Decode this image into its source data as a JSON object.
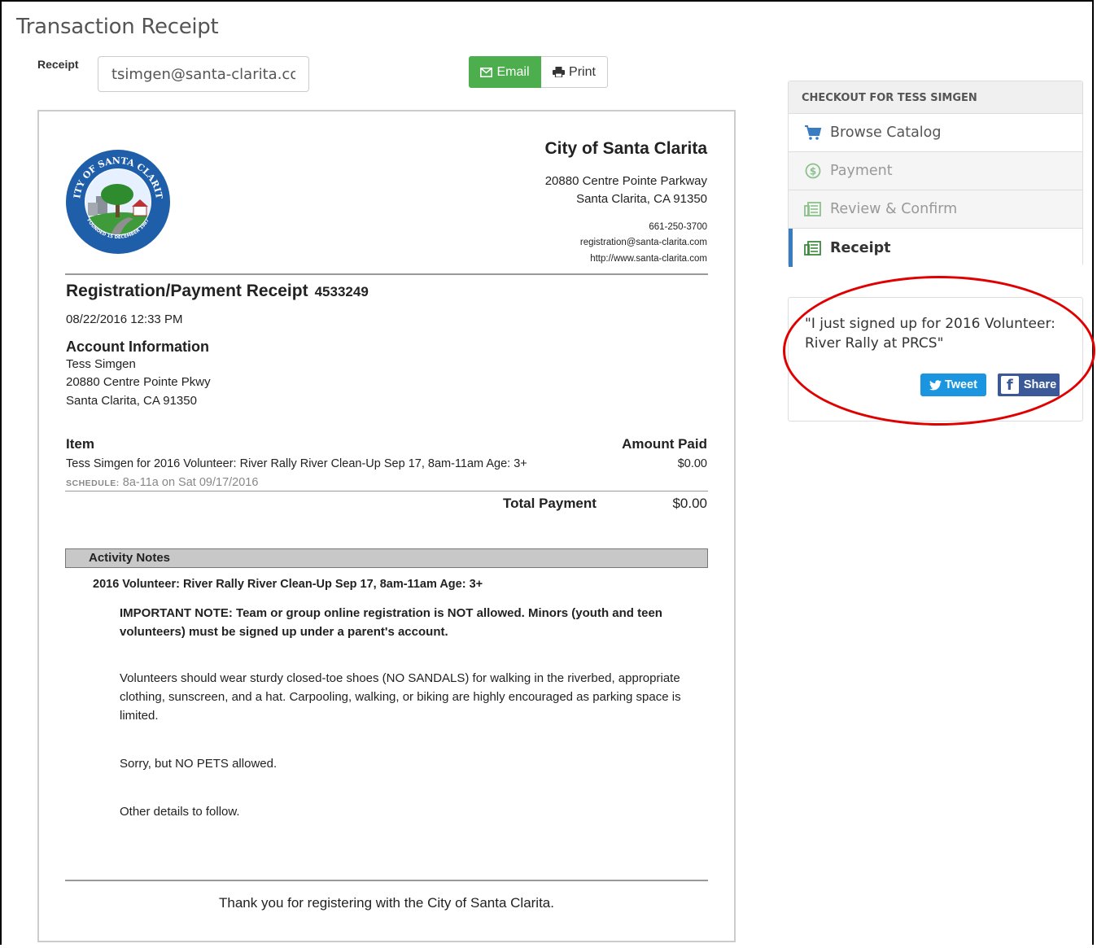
{
  "page": {
    "title": "Transaction Receipt"
  },
  "receipt_form": {
    "label": "Receipt",
    "email_value": "tsimgen@santa-clarita.com",
    "email_button": "Email",
    "print_button": "Print"
  },
  "organization": {
    "name": "City of Santa Clarita",
    "address_line1": "20880 Centre Pointe Parkway",
    "address_line2": "Santa Clarita, CA 91350",
    "phone": "661-250-3700",
    "email": "registration@santa-clarita.com",
    "website": "http://www.santa-clarita.com",
    "seal_text_top": "CITY OF SANTA CLARITA",
    "seal_text_bottom": "FOUNDED 15 DECEMBER 1987"
  },
  "receipt": {
    "title": "Registration/Payment Receipt",
    "number": "4533249",
    "datetime": "08/22/2016 12:33 PM",
    "account_heading": "Account Information",
    "account_name": "Tess Simgen",
    "account_address1": "20880 Centre Pointe Pkwy",
    "account_address2": "Santa Clarita, CA 91350",
    "item_header": "Item",
    "amount_header": "Amount Paid",
    "item_description": "Tess Simgen for 2016 Volunteer: River Rally River Clean-Up Sep 17, 8am-11am Age: 3+",
    "item_amount": "$0.00",
    "schedule_label": "SCHEDULE:",
    "schedule_value": "8a-11a on Sat 09/17/2016",
    "total_label": "Total Payment",
    "total_amount": "$0.00"
  },
  "activity_notes": {
    "heading": "Activity Notes",
    "activity_title": "2016 Volunteer: River Rally River Clean-Up Sep 17, 8am-11am Age: 3+",
    "important": "IMPORTANT NOTE: Team or group online registration is NOT allowed.  Minors (youth and teen volunteers) must be signed up under a parent's account.",
    "paragraph1": "Volunteers should wear sturdy closed-toe shoes (NO SANDALS) for walking in the riverbed, appropriate clothing, sunscreen, and a hat. Carpooling, walking, or biking are highly encouraged as parking space is limited.",
    "paragraph2": "Sorry, but NO PETS allowed.",
    "paragraph3": "Other details to follow."
  },
  "footer": {
    "thanks": "Thank you for registering with the City of Santa Clarita."
  },
  "checkout": {
    "heading": "CHECKOUT FOR TESS SIMGEN",
    "steps": [
      {
        "label": "Browse Catalog",
        "icon": "cart-icon",
        "state": "link"
      },
      {
        "label": "Payment",
        "icon": "dollar-icon",
        "state": "disabled"
      },
      {
        "label": "Review & Confirm",
        "icon": "receipt-icon",
        "state": "disabled"
      },
      {
        "label": "Receipt",
        "icon": "receipt-icon",
        "state": "active"
      }
    ]
  },
  "share": {
    "text": "\"I just signed up for 2016 Volunteer: River Rally at PRCS\"",
    "tweet_label": "Tweet",
    "share_label": "Share"
  },
  "colors": {
    "email_button": "#4cae4c",
    "active_step_accent": "#3a7cc2",
    "tweet": "#1b95e0",
    "facebook": "#3b5998",
    "annotation": "#e00000"
  }
}
